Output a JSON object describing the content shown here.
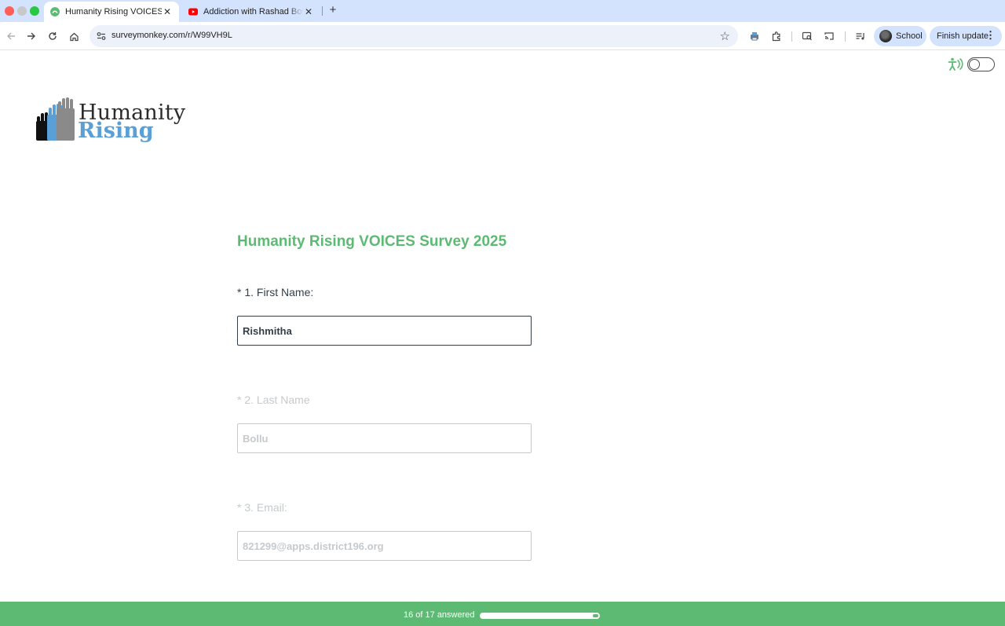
{
  "browser": {
    "tabs": [
      {
        "title": "Humanity Rising VOICES Surv",
        "favicon": "surveymonkey-icon",
        "active": true
      },
      {
        "title": "Addiction with Rashad Bowtie",
        "favicon": "youtube-icon",
        "active": false
      }
    ],
    "close_glyph": "✕",
    "new_tab_glyph": "+",
    "url": "surveymonkey.com/r/W99VH9L",
    "profile_label": "School",
    "update_label": "Finish update",
    "colors": {
      "tab_strip": "#d3e3fd",
      "omnibox": "#edf2fa"
    }
  },
  "page": {
    "logo": {
      "line1": "Humanity",
      "line2": "Rising"
    },
    "survey_title": "Humanity Rising VOICES Survey 2025",
    "questions": [
      {
        "label": "* 1. First Name:",
        "value": "Rishmitha",
        "active": true
      },
      {
        "label": "* 2. Last Name",
        "value": "Bollu",
        "active": false
      },
      {
        "label": "* 3. Email:",
        "value": "821299@apps.district196.org",
        "active": false
      }
    ],
    "accessibility_toggle": {
      "icon": "accessibility-icon",
      "on": false
    },
    "progress": {
      "text": "16 of 17 answered",
      "answered": 16,
      "total": 17,
      "fraction": 0.94
    },
    "colors": {
      "accent": "#5cba73",
      "logo_blue": "#5aa0d6",
      "text": "#333e48",
      "muted": "#c6cacd"
    }
  }
}
